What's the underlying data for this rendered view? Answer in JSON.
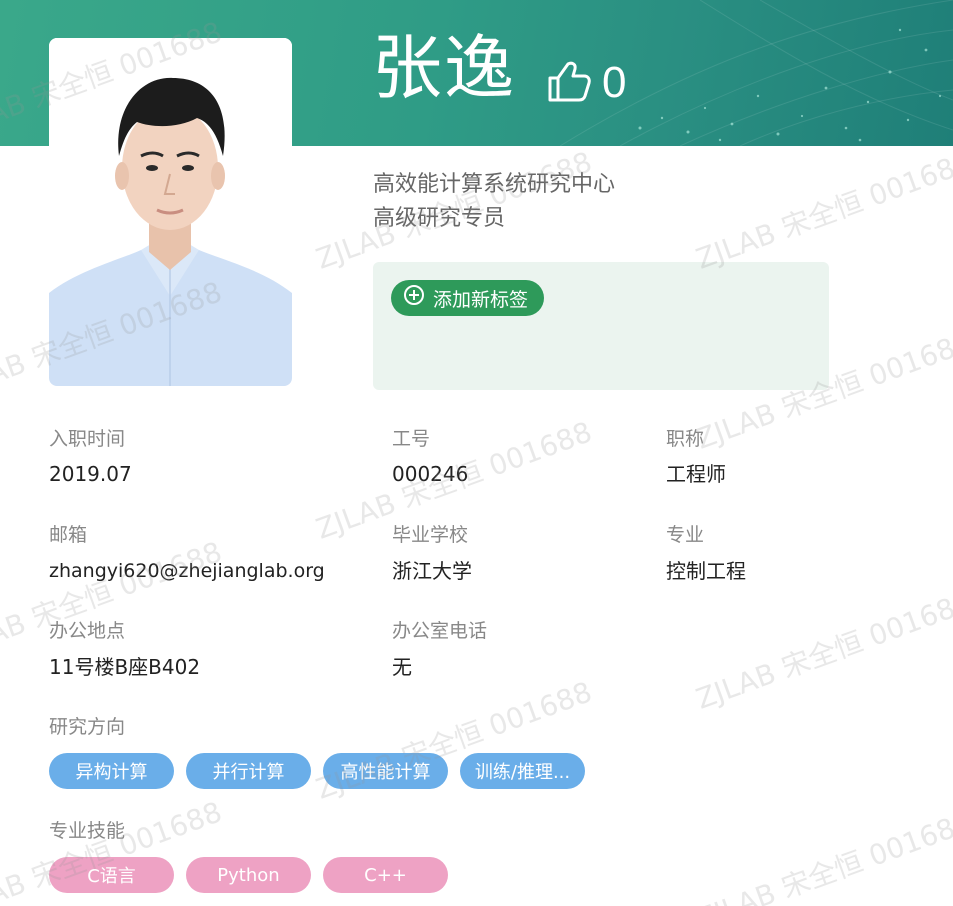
{
  "profile": {
    "name": "张逸",
    "like_count": "0",
    "department": "高效能计算系统研究中心",
    "position": "高级研究专员"
  },
  "tags": {
    "add_label": "添加新标签"
  },
  "fields": {
    "hire_date": {
      "label": "入职时间",
      "value": "2019.07"
    },
    "employee_id": {
      "label": "工号",
      "value": "000246"
    },
    "job_title": {
      "label": "职称",
      "value": "工程师"
    },
    "email": {
      "label": "邮箱",
      "value": "zhangyi620@zhejianglab.org"
    },
    "school": {
      "label": "毕业学校",
      "value": "浙江大学"
    },
    "major": {
      "label": "专业",
      "value": "控制工程"
    },
    "office": {
      "label": "办公地点",
      "value": "11号楼B座B402"
    },
    "office_phone": {
      "label": "办公室电话",
      "value": "无"
    }
  },
  "research": {
    "label": "研究方向",
    "items": [
      "异构计算",
      "并行计算",
      "高性能计算",
      "训练/推理..."
    ]
  },
  "skills": {
    "label": "专业技能",
    "items": [
      "C语言",
      "Python",
      "C++"
    ]
  },
  "watermark": {
    "text": "ZJLAB 宋全恒 001688"
  },
  "colors": {
    "banner": "#2f9c86",
    "add_button": "#2e9a5a",
    "tag_panel": "#ebf4ef",
    "research_chip": "#6aaee9",
    "skill_chip": "#eea2c4"
  },
  "icons": {
    "like": "thumbs-up-icon",
    "add": "plus-circle-icon"
  }
}
